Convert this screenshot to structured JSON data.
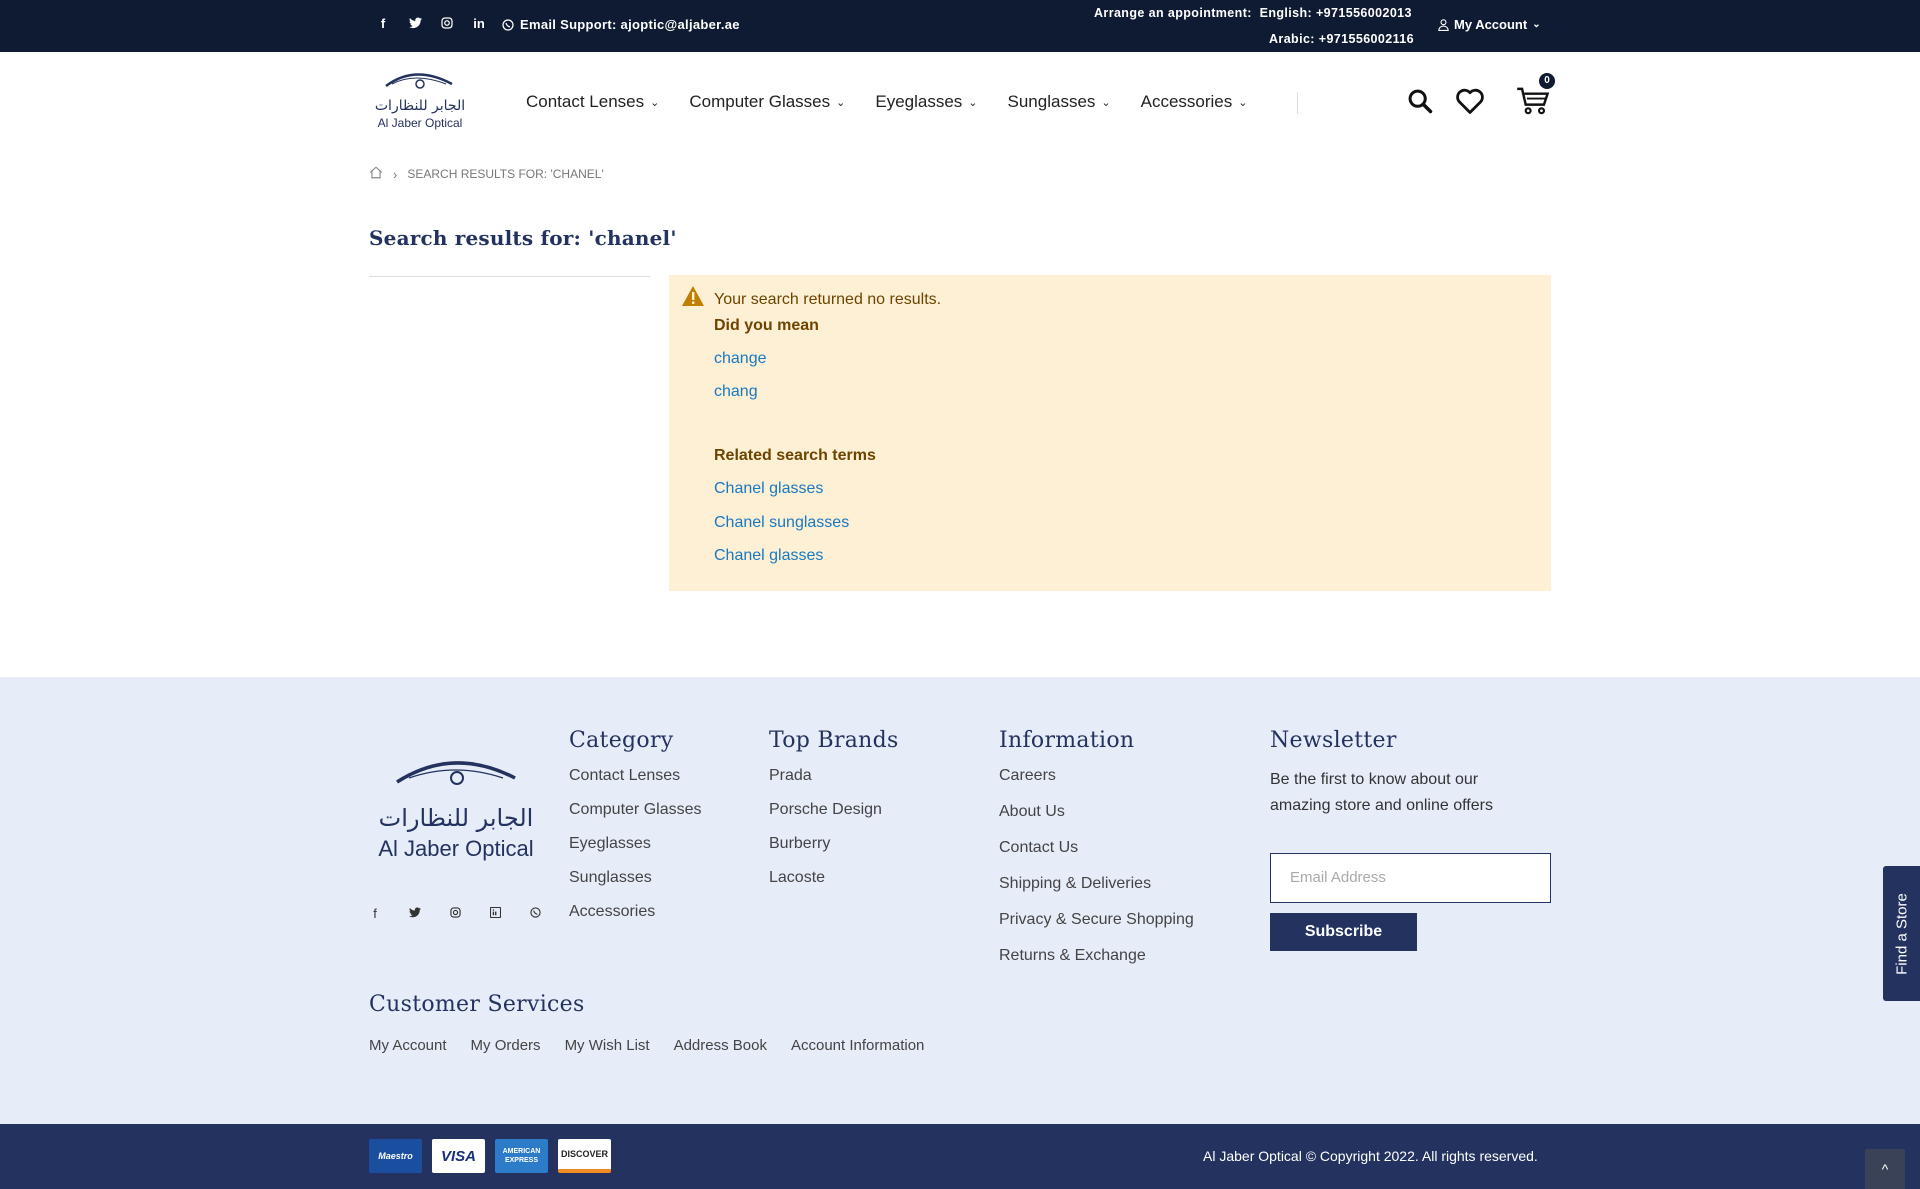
{
  "topbar": {
    "social_icons": [
      "facebook-icon",
      "twitter-icon",
      "instagram-icon",
      "linkedin-icon"
    ],
    "support_label": "Email Support: ajoptic@aljaber.ae",
    "appointment_label": "Arrange an appointment:",
    "english_line": "English: +971556002013",
    "arabic_line": "Arabic:  +971556002116",
    "account_label": "My Account"
  },
  "logo": {
    "arabic": "الجابر للنظارات",
    "english": "Al Jaber Optical"
  },
  "nav": {
    "items": [
      "Contact Lenses",
      "Computer Glasses",
      "Eyeglasses",
      "Sunglasses",
      "Accessories"
    ]
  },
  "cart": {
    "count": "0"
  },
  "breadcrumb": {
    "current": "SEARCH RESULTS FOR: 'CHANEL'"
  },
  "page": {
    "title": "Search results for: 'chanel'"
  },
  "notice": {
    "message": "Your search returned no results.",
    "did_you_mean_heading": "Did you mean",
    "suggestions": [
      "change",
      "chang"
    ],
    "related_heading": "Related search terms",
    "related": [
      "Chanel glasses",
      "Chanel sunglasses",
      "Chanel glasses"
    ]
  },
  "footer": {
    "category": {
      "title": "Category",
      "items": [
        "Contact Lenses",
        "Computer Glasses",
        "Eyeglasses",
        "Sunglasses",
        "Accessories"
      ]
    },
    "brands": {
      "title": "Top Brands",
      "items": [
        "Prada",
        "Porsche Design",
        "Burberry",
        "Lacoste"
      ]
    },
    "information": {
      "title": "Information",
      "items": [
        "Careers",
        "About Us",
        "Contact Us",
        "Shipping & Deliveries",
        "Privacy & Secure Shopping",
        "Returns & Exchange"
      ]
    },
    "newsletter": {
      "title": "Newsletter",
      "text": "Be the first to know about our amazing store and online offers",
      "placeholder": "Email Address",
      "button": "Subscribe"
    },
    "customer_services": {
      "title": "Customer Services",
      "links": [
        "My Account",
        "My Orders",
        "My Wish List",
        "Address Book",
        "Account Information"
      ]
    },
    "find_store": "Find a Store",
    "cards": [
      "Maestro",
      "VISA",
      "AMERICAN EXPRESS",
      "DISCOVER"
    ],
    "copyright": "Al Jaber Optical © Copyright 2022. All rights reserved.",
    "totop": "^"
  },
  "colors": {
    "navy": "#23325e",
    "topbar": "#0f1b33",
    "notice_bg": "#fdf0d5",
    "link": "#1979c3",
    "footer_bg": "#e6ecf8"
  }
}
